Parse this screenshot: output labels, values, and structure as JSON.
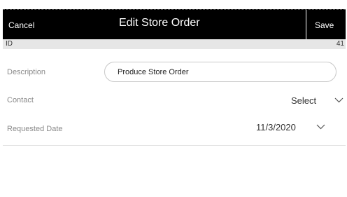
{
  "header": {
    "cancel_label": "Cancel",
    "title": "Edit Store Order",
    "save_label": "Save"
  },
  "id_row": {
    "label": "ID",
    "value": "41"
  },
  "form": {
    "description": {
      "label": "Description",
      "value": "Produce Store Order"
    },
    "contact": {
      "label": "Contact",
      "value": "Select",
      "icon": "chevron-down-icon"
    },
    "requested_date": {
      "label": "Requested Date",
      "value": "11/3/2020",
      "icon": "chevron-down-icon"
    }
  },
  "colors": {
    "header_bg": "#000000",
    "header_text": "#ffffff",
    "id_bar_bg": "#e6e6e6",
    "label_text": "#8a8a8a",
    "value_text": "#333333"
  }
}
